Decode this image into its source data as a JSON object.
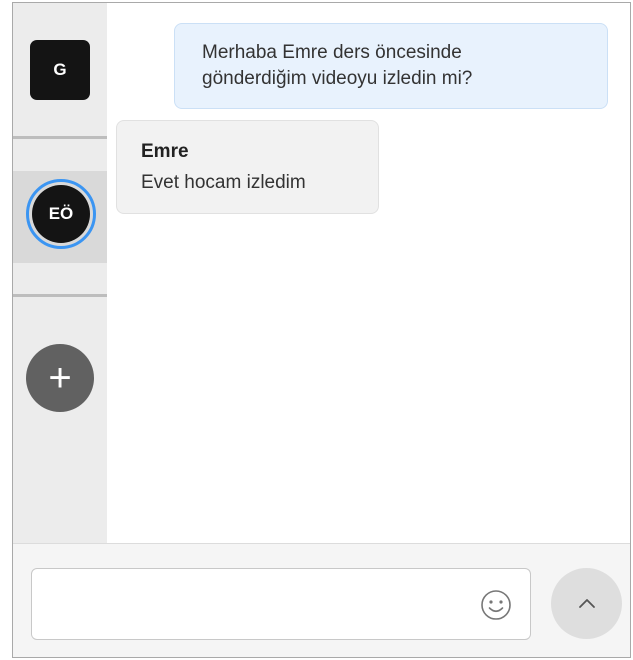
{
  "sidebar": {
    "contacts": [
      {
        "initials": "G"
      },
      {
        "initials": "EÖ"
      }
    ],
    "add_label": "+"
  },
  "conversation": {
    "messages": [
      {
        "direction": "outgoing",
        "text_line1": "Merhaba Emre ders öncesinde",
        "text_line2": "gönderdiğim videoyu izledin mi?"
      },
      {
        "direction": "incoming",
        "sender": "Emre",
        "text": "Evet hocam izledim"
      }
    ]
  },
  "composer": {
    "placeholder": "",
    "value": "",
    "emoji_icon": "smiley-icon",
    "send_icon": "chevron-up-icon"
  },
  "colors": {
    "accent": "#3b95f2",
    "outgoing_bubble": "#e8f2fd",
    "incoming_bubble": "#f2f2f2",
    "avatar": "#141414",
    "add_button": "#616161"
  }
}
